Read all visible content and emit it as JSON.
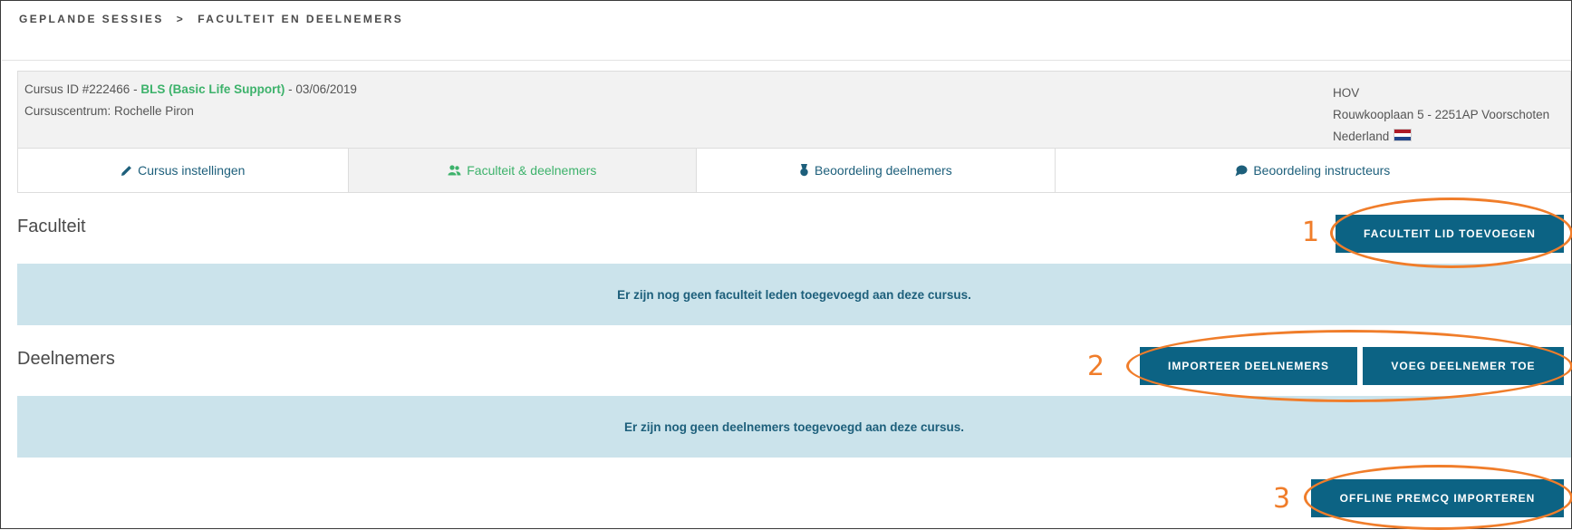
{
  "breadcrumb": {
    "items": [
      "GEPLANDE SESSIES",
      "FACULTEIT EN DEELNEMERS"
    ],
    "separator": ">"
  },
  "course": {
    "id_prefix": "Cursus ID #222466 - ",
    "name": "BLS (Basic Life Support)",
    "date_suffix": " - 03/06/2019",
    "center": "Cursuscentrum: Rochelle Piron",
    "location_code": "HOV",
    "address": "Rouwkooplaan 5 - 2251AP Voorschoten",
    "country": "Nederland"
  },
  "tabs": [
    {
      "label": "Cursus instellingen",
      "icon": "pencil-icon",
      "active": false
    },
    {
      "label": "Faculteit & deelnemers",
      "icon": "users-icon",
      "active": true
    },
    {
      "label": "Beoordeling deelnemers",
      "icon": "medal-icon",
      "active": false
    },
    {
      "label": "Beoordeling instructeurs",
      "icon": "chat-bubble-icon",
      "active": false
    }
  ],
  "faculty": {
    "title": "Faculteit",
    "add_button": "FACULTEIT LID TOEVOEGEN",
    "empty_message": "Er zijn nog geen faculteit leden toegevoegd aan deze cursus."
  },
  "participants": {
    "title": "Deelnemers",
    "import_button": "IMPORTEER DEELNEMERS",
    "add_button": "VOEG DEELNEMER TOE",
    "empty_message": "Er zijn nog geen deelnemers toegevoegd aan deze cursus."
  },
  "offline_button": "OFFLINE PREMCQ IMPORTEREN",
  "annotations": [
    "1",
    "2",
    "3"
  ],
  "colors": {
    "primary": "#0c6384",
    "accent_green": "#3db26b",
    "link_blue": "#1d5f7b",
    "notice_bg": "#cbe3eb",
    "annotation_orange": "#f07d2a"
  }
}
